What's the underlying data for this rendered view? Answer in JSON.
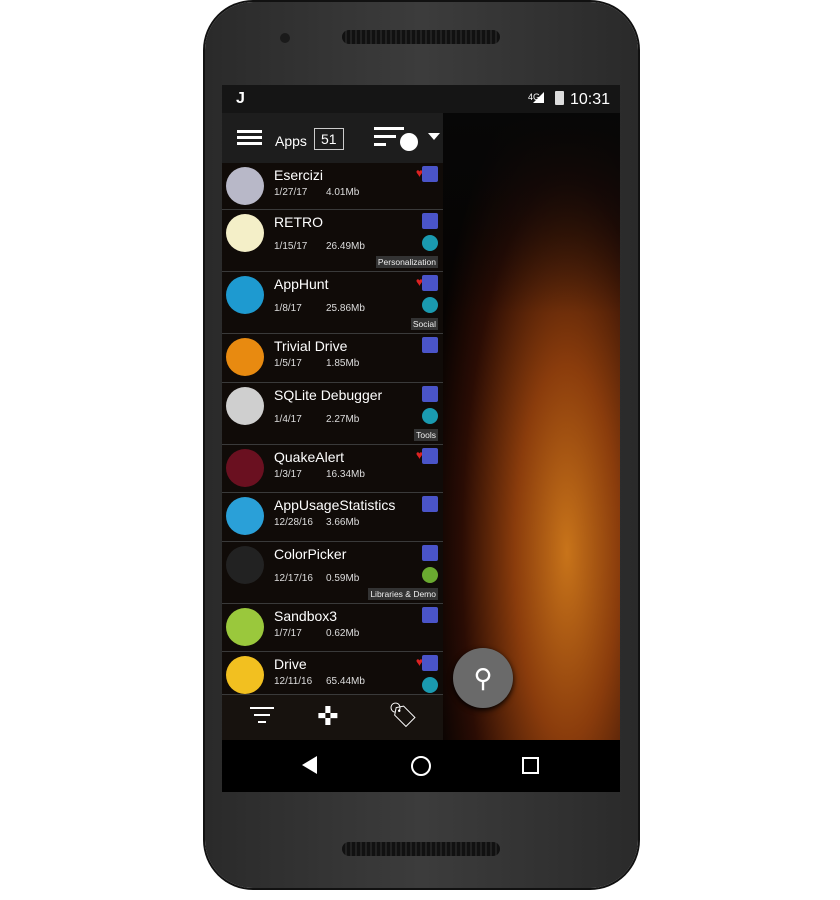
{
  "status": {
    "carrier_letter": "J",
    "network": "4G",
    "time": "10:31"
  },
  "toolbar": {
    "label": "Apps",
    "count": "51"
  },
  "apps": [
    {
      "name": "Esercizi",
      "date": "1/27/17",
      "size": "4.01Mb",
      "favorite": true,
      "category": "",
      "cat_color": "",
      "icon_color": "#b8b8c8"
    },
    {
      "name": "RETRO",
      "date": "1/15/17",
      "size": "26.49Mb",
      "favorite": false,
      "category": "Personalization",
      "cat_color": "#1a9ab0",
      "icon_color": "#f4efc8"
    },
    {
      "name": "AppHunt",
      "date": "1/8/17",
      "size": "25.86Mb",
      "favorite": true,
      "category": "Social",
      "cat_color": "#1a9ab0",
      "icon_color": "#1e9ad0"
    },
    {
      "name": "Trivial Drive",
      "date": "1/5/17",
      "size": "1.85Mb",
      "favorite": false,
      "category": "",
      "cat_color": "",
      "icon_color": "#e88a10"
    },
    {
      "name": "SQLite Debugger",
      "date": "1/4/17",
      "size": "2.27Mb",
      "favorite": false,
      "category": "Tools",
      "cat_color": "#1a9ab0",
      "icon_color": "#cfcfcf"
    },
    {
      "name": "QuakeAlert",
      "date": "1/3/17",
      "size": "16.34Mb",
      "favorite": true,
      "category": "",
      "cat_color": "",
      "icon_color": "#6a1020"
    },
    {
      "name": "AppUsageStatistics",
      "date": "12/28/16",
      "size": "3.66Mb",
      "favorite": false,
      "category": "",
      "cat_color": "",
      "icon_color": "#2aa0d8"
    },
    {
      "name": "ColorPicker",
      "date": "12/17/16",
      "size": "0.59Mb",
      "favorite": false,
      "category": "Libraries & Demo",
      "cat_color": "#6aaa30",
      "icon_color": "#222"
    },
    {
      "name": "Sandbox3",
      "date": "1/7/17",
      "size": "0.62Mb",
      "favorite": false,
      "category": "",
      "cat_color": "",
      "icon_color": "#9ac83c"
    },
    {
      "name": "Drive",
      "date": "12/11/16",
      "size": "65.44Mb",
      "favorite": true,
      "category": "",
      "cat_color": "#1a9ab0",
      "icon_color": "#f2c020"
    }
  ],
  "icons": {
    "menu": "hamburger-icon",
    "sort": "sort-user-icon",
    "dropdown": "triangle-down-icon",
    "filter": "filter-icon",
    "game": "gamepad-icon",
    "tag": "tag-icon",
    "search": "search-icon",
    "back": "back-icon",
    "home": "home-icon",
    "recent": "recent-icon"
  }
}
